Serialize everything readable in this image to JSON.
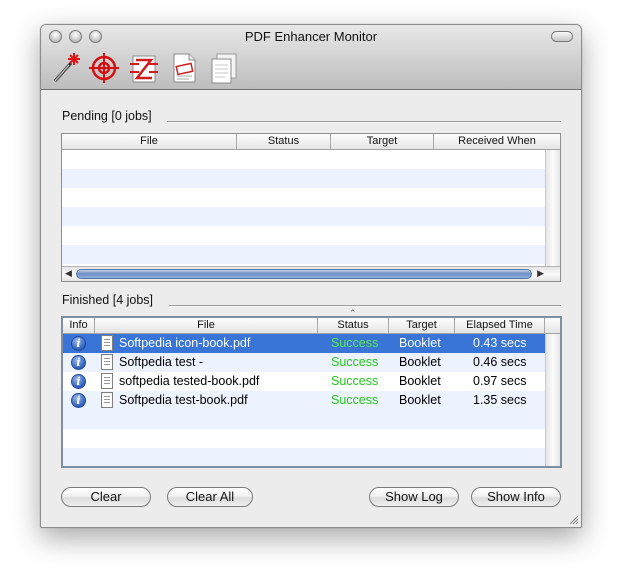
{
  "window": {
    "title": "PDF Enhancer Monitor"
  },
  "toolbar": {
    "tools": [
      "wand-icon",
      "target-icon",
      "document-transform-icon",
      "stamp-document-icon",
      "copies-icon"
    ]
  },
  "pending": {
    "label": "Pending [0 jobs]",
    "columns": [
      "File",
      "Status",
      "Target",
      "Received When"
    ]
  },
  "finished": {
    "label": "Finished [4 jobs]",
    "columns": [
      "Info",
      "File",
      "Status",
      "Target",
      "Elapsed Time"
    ],
    "rows": [
      {
        "file": "Softpedia icon-book.pdf",
        "status": "Success",
        "target": "Booklet",
        "elapsed": "0.43 secs",
        "selected": true
      },
      {
        "file": "Softpedia test -",
        "status": "Success",
        "target": "Booklet",
        "elapsed": "0.46 secs",
        "selected": false
      },
      {
        "file": "softpedia tested-book.pdf",
        "status": "Success",
        "target": "Booklet",
        "elapsed": "0.97 secs",
        "selected": false
      },
      {
        "file": "Softpedia test-book.pdf",
        "status": "Success",
        "target": "Booklet",
        "elapsed": "1.35 secs",
        "selected": false
      }
    ]
  },
  "buttons": {
    "clear": "Clear",
    "clear_all": "Clear All",
    "show_log": "Show Log",
    "show_info": "Show Info"
  },
  "colors": {
    "selection": "#3875d7",
    "success": "#23c81b",
    "alt_row": "#edf3fe"
  }
}
